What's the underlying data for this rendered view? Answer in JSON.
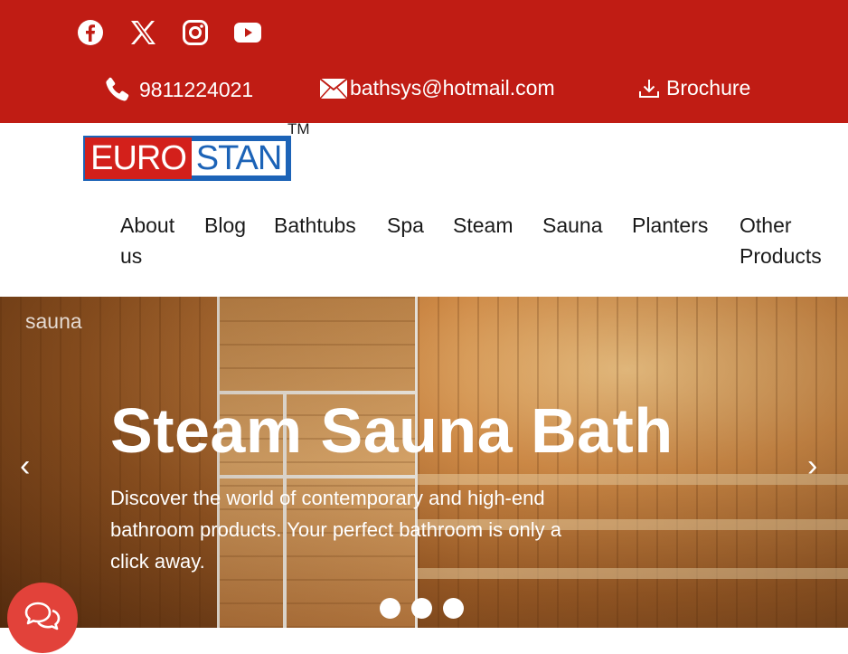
{
  "social": {
    "icons": [
      "facebook-icon",
      "x-icon",
      "instagram-icon",
      "youtube-icon"
    ]
  },
  "contact": {
    "phone": "9811224021",
    "email": "bathsys@hotmail.com",
    "brochure": "Brochure"
  },
  "logo": {
    "part1": "EURO",
    "part2": "STAN",
    "tm": "TM"
  },
  "nav": {
    "items": [
      "About us",
      "Blog",
      "Bathtubs",
      "Spa",
      "Steam",
      "Sauna",
      "Planters",
      "Other Products"
    ]
  },
  "hero": {
    "corner_label": "sauna",
    "title": "Steam Sauna Bath",
    "text": "Discover the world of contemporary and high-end bathroom products. Your perfect bathroom is only a click away.",
    "prev": "‹",
    "next": "›",
    "slide_count": 3
  },
  "colors": {
    "topbar": "#c01c14",
    "logo_red": "#d3201b",
    "logo_blue": "#1c63b7",
    "chat": "#e2423a"
  }
}
